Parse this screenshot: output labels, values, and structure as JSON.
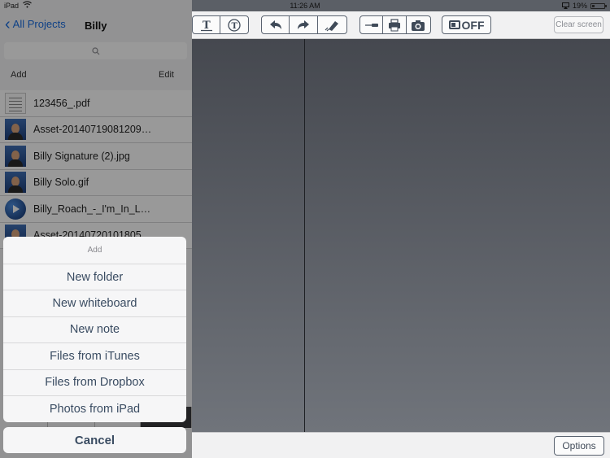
{
  "status_bar": {
    "carrier": "iPad",
    "time": "11:26 AM",
    "battery": "19%"
  },
  "nav": {
    "back_label": "All Projects",
    "title": "Billy"
  },
  "list_header": {
    "add_label": "Add",
    "edit_label": "Edit"
  },
  "files": [
    {
      "name": "123456_.pdf",
      "icon": "pdf-document-icon"
    },
    {
      "name": "Asset-20140719081209…",
      "icon": "photo-thumbnail-icon"
    },
    {
      "name": "Billy Signature (2).jpg",
      "icon": "photo-thumbnail-icon"
    },
    {
      "name": "Billy Solo.gif",
      "icon": "photo-thumbnail-icon"
    },
    {
      "name": "Billy_Roach_-_I'm_In_L…",
      "icon": "video-play-icon"
    },
    {
      "name": "Asset-20140720101805",
      "icon": "photo-thumbnail-icon"
    }
  ],
  "action_sheet": {
    "title": "Add",
    "items": [
      "New folder",
      "New whiteboard",
      "New note",
      "Files from iTunes",
      "Files from Dropbox",
      "Photos from iPad"
    ],
    "cancel_label": "Cancel"
  },
  "toolbar": {
    "icons": [
      "text-tool-icon",
      "circled-text-icon",
      "undo-icon",
      "redo-icon",
      "eraser-icon",
      "pen-tool-icon",
      "print-icon",
      "camera-icon",
      "toggle-icon"
    ],
    "toggle_label": "OFF",
    "clear_label": "Clear screen"
  },
  "footer": {
    "options_label": "Options"
  },
  "colors": {
    "accent_blue": "#1a6de0",
    "sheet_text": "#3a4c62",
    "canvas_top": "#45484f",
    "canvas_bottom": "#70747b"
  }
}
